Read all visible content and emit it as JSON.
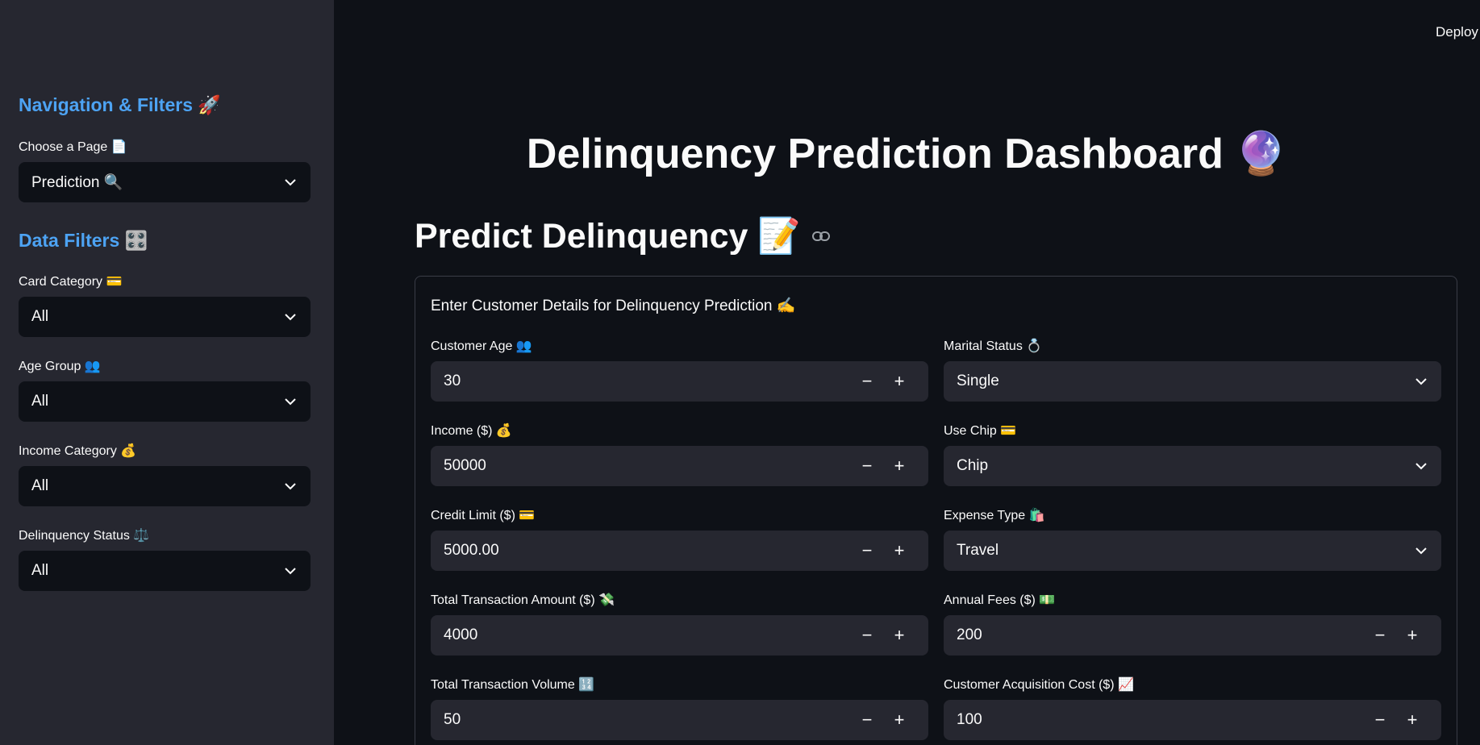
{
  "header": {
    "deploy_label": "Deploy"
  },
  "sidebar": {
    "nav_heading": "Navigation & Filters 🚀",
    "page_select": {
      "label": "Choose a Page 📄",
      "value": "Prediction 🔍"
    },
    "filters_heading": "Data Filters 🎛️",
    "filters": [
      {
        "label": "Card Category 💳",
        "value": "All"
      },
      {
        "label": "Age Group 👥",
        "value": "All"
      },
      {
        "label": "Income Category 💰",
        "value": "All"
      },
      {
        "label": "Delinquency Status ⚖️",
        "value": "All"
      }
    ]
  },
  "main": {
    "title": "Delinquency Prediction Dashboard 🔮",
    "section_title": "Predict Delinquency 📝",
    "form": {
      "caption": "Enter Customer Details for Delinquency Prediction ✍️",
      "left_fields": [
        {
          "label": "Customer Age 👥",
          "value": "30"
        },
        {
          "label": "Income ($) 💰",
          "value": "50000"
        },
        {
          "label": "Credit Limit ($) 💳",
          "value": "5000.00"
        },
        {
          "label": "Total Transaction Amount ($) 💸",
          "value": "4000"
        },
        {
          "label": "Total Transaction Volume 🔢",
          "value": "50"
        }
      ],
      "right_fields": [
        {
          "label": "Marital Status 💍",
          "value": "Single",
          "kind": "select"
        },
        {
          "label": "Use Chip 💳",
          "value": "Chip",
          "kind": "select"
        },
        {
          "label": "Expense Type 🛍️",
          "value": "Travel",
          "kind": "select"
        },
        {
          "label": "Annual Fees ($) 💵",
          "value": "200",
          "kind": "number"
        },
        {
          "label": "Customer Acquisition Cost ($) 📈",
          "value": "100",
          "kind": "number"
        }
      ]
    }
  },
  "icons": {
    "chevron": "chevron-down-icon",
    "link": "link-icon",
    "minus": "minus-icon",
    "plus": "plus-icon"
  },
  "colors": {
    "background": "#0e1117",
    "sidebar": "#262730",
    "input": "#262730",
    "accent": "#4da3f3",
    "text": "#fafafa"
  }
}
